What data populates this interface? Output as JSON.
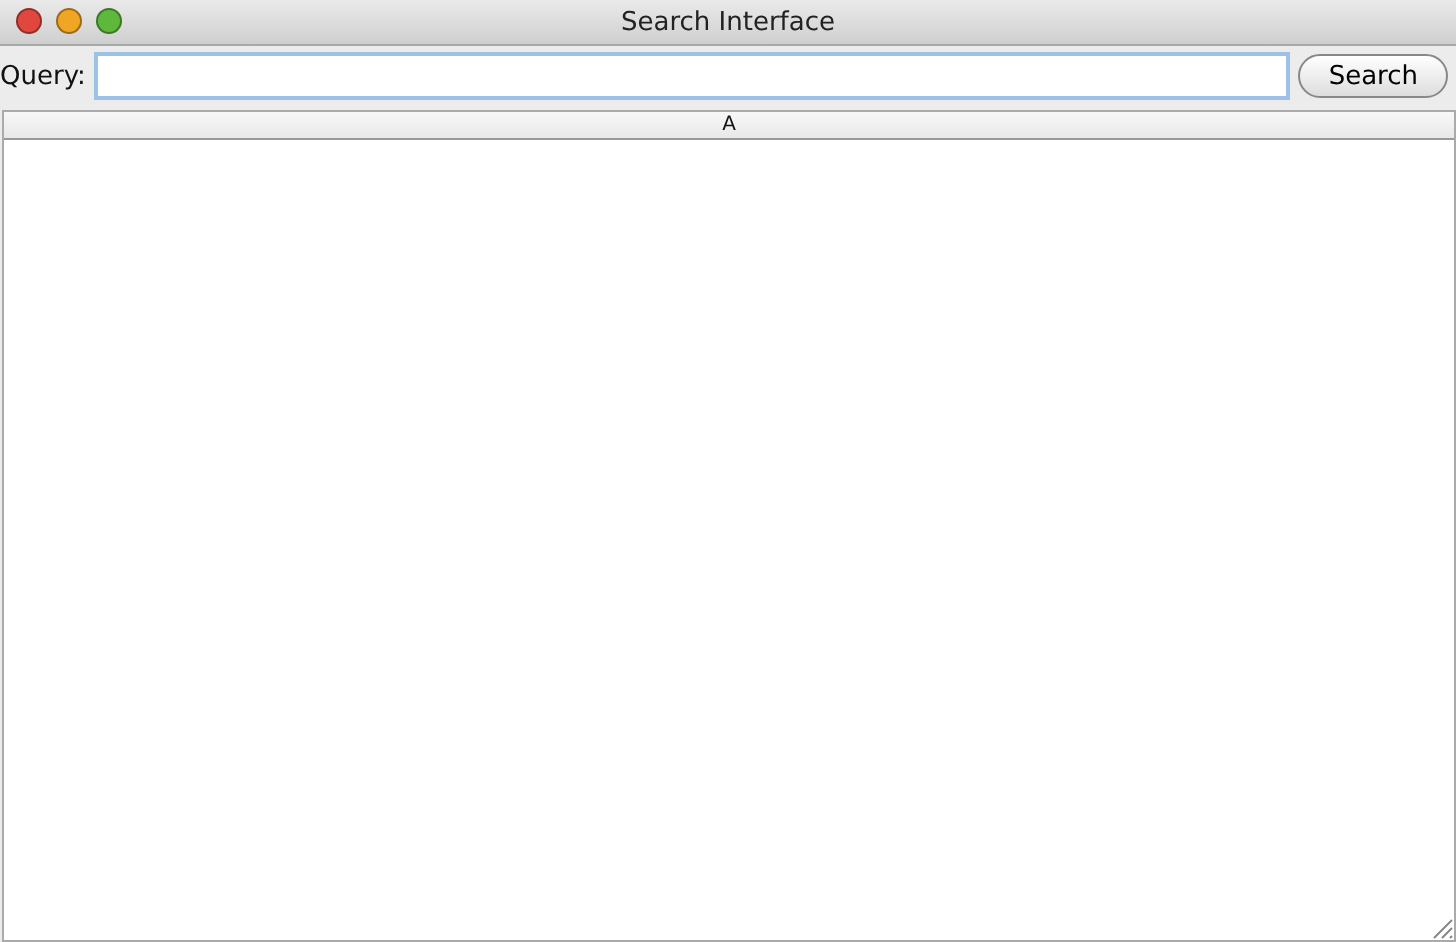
{
  "window": {
    "title": "Search Interface"
  },
  "query": {
    "label": "Query:"
  },
  "buttons": [
    {
      "label": "Search"
    }
  ],
  "table": {
    "columns": [
      "A"
    ]
  }
}
